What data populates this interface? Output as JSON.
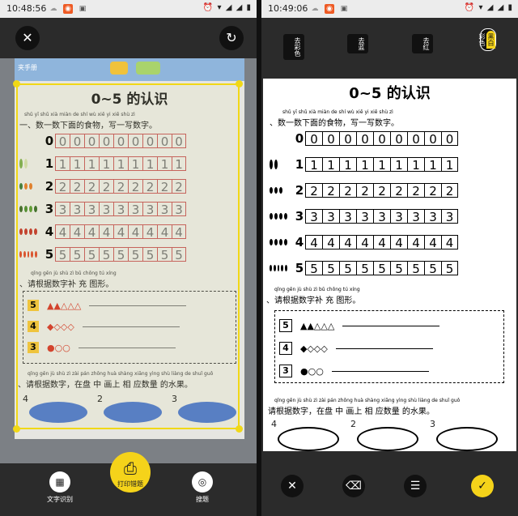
{
  "left": {
    "status": {
      "time": "10:48:56"
    },
    "close_icon": "close-icon",
    "rotate_icon": "rotate-icon",
    "banner_text": "夹手册",
    "worksheet": {
      "title": "0~5 的认识",
      "section1_pinyin": "shǔ yī shǔ xià miàn de shí wù   xiě yi xiě shù zì",
      "section1": "一、数一数下面的食物，写一写数字。",
      "rows": [
        {
          "num": "0",
          "cells": [
            "0",
            "0",
            "0",
            "0",
            "0",
            "0",
            "0",
            "0",
            "0"
          ]
        },
        {
          "num": "1",
          "cells": [
            "1",
            "1",
            "1",
            "1",
            "1",
            "1",
            "1",
            "1",
            "1"
          ]
        },
        {
          "num": "2",
          "cells": [
            "2",
            "2",
            "2",
            "2",
            "2",
            "2",
            "2",
            "2",
            "2"
          ]
        },
        {
          "num": "3",
          "cells": [
            "3",
            "3",
            "3",
            "3",
            "3",
            "3",
            "3",
            "3",
            "3"
          ]
        },
        {
          "num": "4",
          "cells": [
            "4",
            "4",
            "4",
            "4",
            "4",
            "4",
            "4",
            "4",
            "4"
          ]
        },
        {
          "num": "5",
          "cells": [
            "5",
            "5",
            "5",
            "5",
            "5",
            "5",
            "5",
            "5",
            "5"
          ]
        }
      ],
      "section2_pinyin": "qǐng gēn jù shù zì  bǔ chōng tú xíng",
      "section2": "、请根据数字补 充 图形。",
      "shape_rows": [
        {
          "num": "5",
          "shapes": "▲▲△△△"
        },
        {
          "num": "4",
          "shapes": "◆◇◇◇"
        },
        {
          "num": "3",
          "shapes": "●○○"
        }
      ],
      "section3_pinyin": "qǐng gēn jù shù zì   zài pán zhōng huà shàng xiāng yìng shù liàng de shuǐ guǒ",
      "section3": "、请根据数字，在盘 中 画上 相 应数量 的水果。",
      "plates": [
        "4",
        "2",
        "3"
      ]
    },
    "tools": [
      {
        "label": "文字识别",
        "icon": "ocr-icon"
      },
      {
        "label": "打印错题",
        "icon": "print-icon"
      },
      {
        "label": "搜题",
        "icon": "search-question-icon"
      }
    ]
  },
  "right": {
    "status": {
      "time": "10:49:06"
    },
    "filters": [
      "去彩色",
      "去蓝",
      "去红"
    ],
    "mode_toggle": [
      "黑白",
      "彩色"
    ],
    "worksheet": {
      "title": "0~5 的认识",
      "section1_pinyin": "shǔ yī shǔ xià miàn de shí wù   xiě yi xiě shù zì",
      "section1": "、数一数下面的食物，写一写数字。",
      "section2_pinyin": "qǐng gēn jù shù zì  bǔ chōng tú xíng",
      "section2": "、请根据数字补 充 图形。",
      "section3_pinyin": "qǐng gēn jù shù zì   zài pán zhōng huà shàng xiāng yìng shù liàng de shuǐ guǒ",
      "section3": "请根据数字，在盘 中 画上 相 应数量 的水果。"
    },
    "bottom_icons": [
      "close-icon",
      "eraser-icon",
      "adjust-icon",
      "confirm-check-icon"
    ]
  },
  "colors": {
    "accent_yellow": "#f5d31a",
    "crop_border": "#f1d816",
    "bar_bg": "#2b2b2b"
  }
}
